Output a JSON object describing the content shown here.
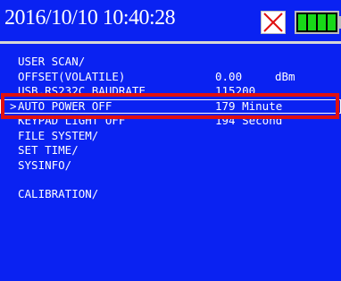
{
  "status": {
    "datetime": "2016/10/10  10:40:28",
    "alert_icon": "red-x-icon",
    "battery_icon": "battery-full-icon",
    "colors": {
      "background": "#0a22f2",
      "text": "#ffffff",
      "battery": "#18d818",
      "highlight": "#e01010"
    }
  },
  "menu": {
    "cursor": ">",
    "items": [
      {
        "label": "USER SCAN/",
        "value": "",
        "unit": ""
      },
      {
        "label": "OFFSET(VOLATILE)",
        "value": "0.00",
        "unit": "dBm"
      },
      {
        "label": "USB,RS232C BAUDRATE",
        "value": "115200",
        "unit": ""
      },
      {
        "label": "AUTO POWER OFF",
        "value": "179 Minute",
        "unit": "",
        "selected": true
      },
      {
        "label": "KEYPAD LIGHT OFF",
        "value": "194 Second",
        "unit": ""
      },
      {
        "label": "FILE SYSTEM/",
        "value": "",
        "unit": ""
      },
      {
        "label": "SET TIME/",
        "value": "",
        "unit": ""
      },
      {
        "label": "SYSINFO/",
        "value": "",
        "unit": ""
      },
      {
        "label": "",
        "value": "",
        "unit": ""
      },
      {
        "label": "CALIBRATION/",
        "value": "",
        "unit": ""
      }
    ]
  }
}
